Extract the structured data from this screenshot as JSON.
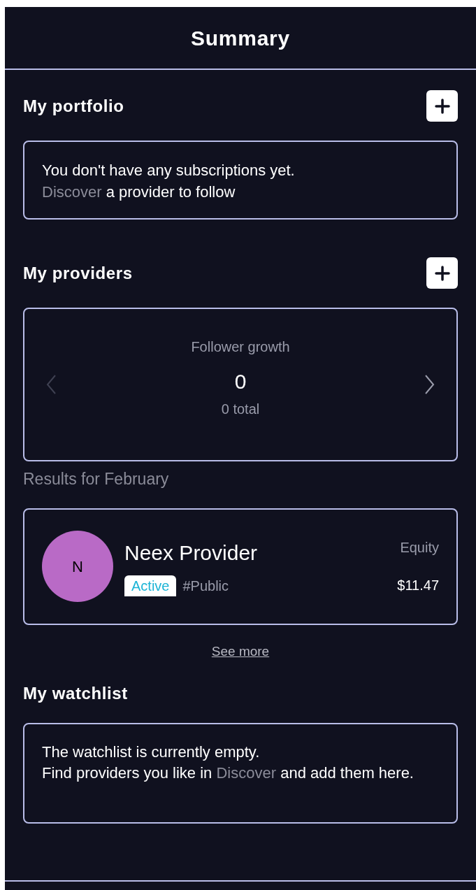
{
  "header": {
    "title": "Summary"
  },
  "portfolio": {
    "title": "My portfolio",
    "message": "You don't have any subscriptions yet.",
    "link": "Discover",
    "message_after": "a provider to follow"
  },
  "providers": {
    "title": "My providers",
    "stats": {
      "label": "Follower growth",
      "value": "0",
      "total": "0 total",
      "prev_disabled": true,
      "next_disabled": false
    },
    "results_label": "Results for February",
    "items": [
      {
        "initial": "N",
        "color": "#b96ac6",
        "name": "Neex Provider",
        "status": "Active",
        "tag": "#Public",
        "metric_label": "Equity",
        "metric_value": "$11.47"
      }
    ],
    "see_more": "See more"
  },
  "watchlist": {
    "title": "My watchlist",
    "message": "The watchlist is currently empty.",
    "message_before": "Find providers you like in",
    "link": "Discover",
    "message_after": "and add them here."
  }
}
